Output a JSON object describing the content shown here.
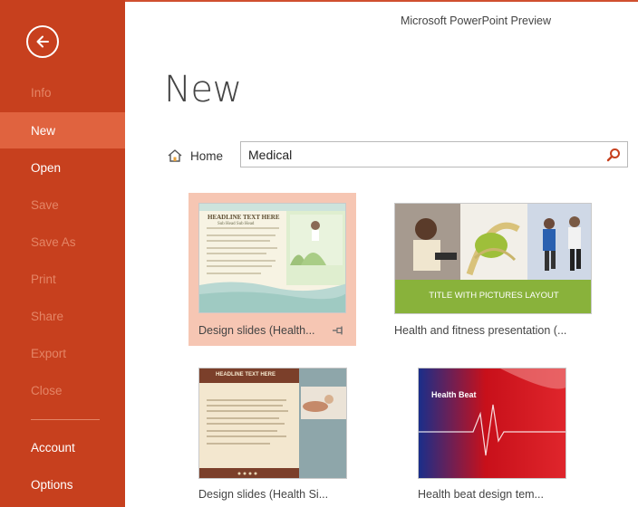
{
  "window": {
    "title": "Microsoft PowerPoint Preview"
  },
  "sidebar": {
    "items": [
      {
        "label": "Info",
        "state": "disabled"
      },
      {
        "label": "New",
        "state": "selected"
      },
      {
        "label": "Open",
        "state": "normal"
      },
      {
        "label": "Save",
        "state": "disabled"
      },
      {
        "label": "Save As",
        "state": "disabled"
      },
      {
        "label": "Print",
        "state": "disabled"
      },
      {
        "label": "Share",
        "state": "disabled"
      },
      {
        "label": "Export",
        "state": "disabled"
      },
      {
        "label": "Close",
        "state": "disabled"
      },
      {
        "label": "Account",
        "state": "normal"
      },
      {
        "label": "Options",
        "state": "normal"
      }
    ]
  },
  "page": {
    "title": "New"
  },
  "breadcrumb": {
    "home_label": "Home"
  },
  "search": {
    "value": "Medical"
  },
  "templates": [
    {
      "label": "Design slides (Health...",
      "selected": true,
      "thumb_headline": "HEADLINE TEXT HERE",
      "thumb_subhead": "Sub Head Sub Head"
    },
    {
      "label": "Health and fitness presentation (...",
      "selected": false,
      "thumb_title": "TITLE WITH PICTURES LAYOUT"
    },
    {
      "label": "Design slides (Health Si...",
      "selected": false,
      "thumb_headline": "HEADLINE TEXT HERE"
    },
    {
      "label": "Health beat design tem...",
      "selected": false,
      "thumb_title": "Health Beat"
    }
  ],
  "colors": {
    "accent": "#c7401e",
    "selected_menu": "#e0633f",
    "disabled_menu_text": "#e48566",
    "selected_card": "#f6c6b3"
  },
  "icons": {
    "back": "back-arrow-icon",
    "home": "home-icon",
    "search": "search-icon",
    "pin": "pin-icon"
  }
}
